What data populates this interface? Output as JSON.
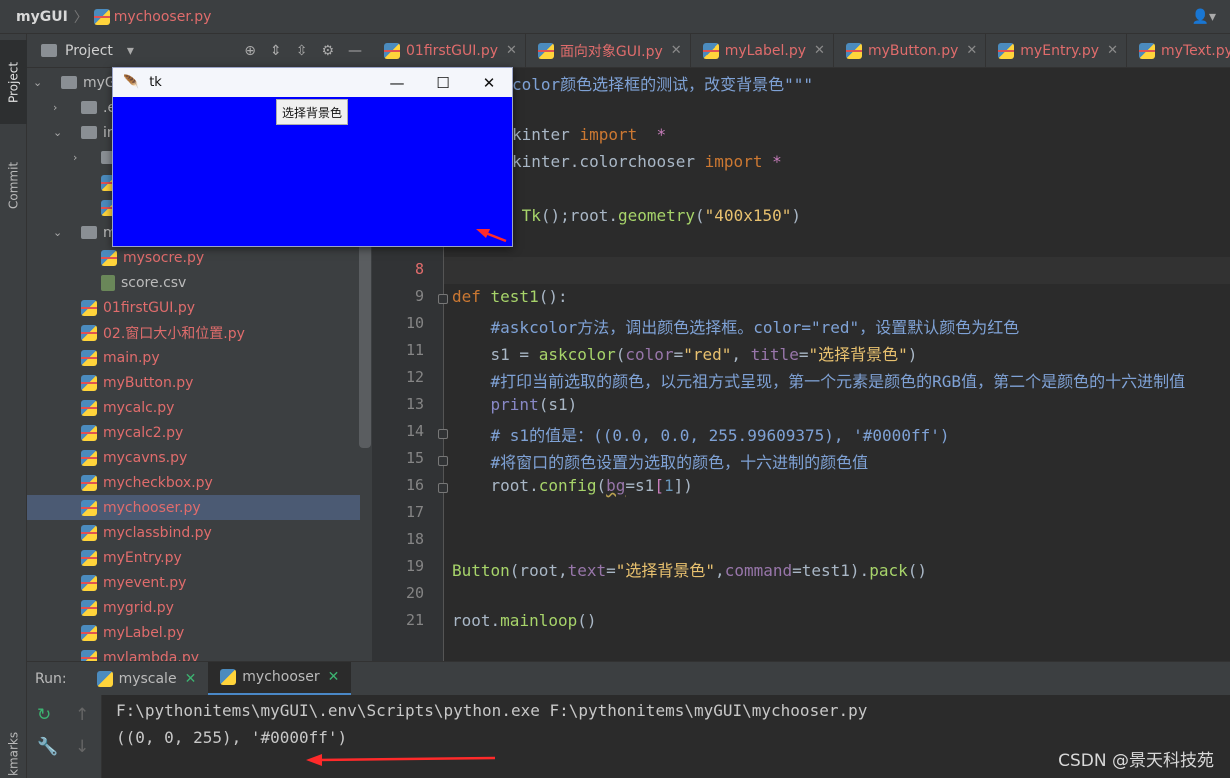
{
  "titlebar": {
    "project": "myGUI",
    "separator": "〉",
    "file": "mychooser.py",
    "user_icon": "user-icon"
  },
  "side": {
    "project_tab": "Project",
    "commit_tab": "Commit",
    "bookmarks_tab": "kmarks"
  },
  "project_panel": {
    "title": "Project",
    "dropdown": "▾"
  },
  "tree": [
    {
      "label": "myG",
      "type": "folder",
      "expanded": true
    },
    {
      "label": ".e",
      "type": "folder",
      "expanded": false
    },
    {
      "label": "in",
      "type": "folder",
      "expanded": true
    },
    {
      "label": "",
      "type": "folder",
      "expanded": false
    },
    {
      "label": "",
      "type": "file"
    },
    {
      "label": "",
      "type": "file"
    },
    {
      "label": "m",
      "type": "folder",
      "expanded": true
    },
    {
      "label": "mysocre.py",
      "type": "py"
    },
    {
      "label": "score.csv",
      "type": "csv"
    },
    {
      "label": "01firstGUI.py",
      "type": "py"
    },
    {
      "label": "02.窗口大小和位置.py",
      "type": "py"
    },
    {
      "label": "main.py",
      "type": "py"
    },
    {
      "label": "myButton.py",
      "type": "py"
    },
    {
      "label": "mycalc.py",
      "type": "py"
    },
    {
      "label": "mycalc2.py",
      "type": "py"
    },
    {
      "label": "mycavns.py",
      "type": "py"
    },
    {
      "label": "mycheckbox.py",
      "type": "py"
    },
    {
      "label": "mychooser.py",
      "type": "py",
      "selected": true
    },
    {
      "label": "myclassbind.py",
      "type": "py"
    },
    {
      "label": "myEntry.py",
      "type": "py"
    },
    {
      "label": "myevent.py",
      "type": "py"
    },
    {
      "label": "mygrid.py",
      "type": "py"
    },
    {
      "label": "myLabel.py",
      "type": "py"
    },
    {
      "label": "mylambda.py",
      "type": "py"
    }
  ],
  "tabs": [
    "01firstGUI.py",
    "面向对象GUI.py",
    "myLabel.py",
    "myButton.py",
    "myEntry.py",
    "myText.py"
  ],
  "line_numbers": [
    "",
    "",
    "",
    "",
    "",
    "",
    "",
    "8",
    "9",
    "10",
    "11",
    "12",
    "13",
    "14",
    "15",
    "16",
    "17",
    "18",
    "19",
    "20",
    "21"
  ],
  "code": {
    "l1_a": "color颜色选择框的测试，改变背景色\"\"\"",
    "l3_a": "kinter ",
    "l3_b": "import",
    "l3_c": "  *",
    "l4_a": "kinter.colorchooser ",
    "l4_b": "import",
    "l4_c": " *",
    "l6_a": " Tk",
    "l6_b": "();root.",
    "l6_c": "geometry",
    "l6_d": "(",
    "l6_e": "\"400x150\"",
    "l6_f": ")",
    "l9_a": "def ",
    "l9_b": "test1",
    "l9_c": "():",
    "l10": "    #askcolor方法，调出颜色选择框。color=\"red\"，设置默认颜色为红色",
    "l11_a": "    s1 = ",
    "l11_b": "askcolor",
    "l11_c": "(",
    "l11_d": "color",
    "l11_e": "=",
    "l11_f": "\"red\"",
    "l11_g": ", ",
    "l11_h": "title",
    "l11_i": "=",
    "l11_j": "\"选择背景色\"",
    "l11_k": ")",
    "l12": "    #打印当前选取的颜色，以元祖方式呈现，第一个元素是颜色的RGB值，第二个是颜色的十六进制值",
    "l13_a": "    ",
    "l13_b": "print",
    "l13_c": "(s1)",
    "l14": "    # s1的值是：((0.0, 0.0, 255.99609375), '#0000ff')",
    "l15": "    #将窗口的颜色设置为选取的颜色，十六进制的颜色值",
    "l16_a": "    root.",
    "l16_b": "config",
    "l16_c": "(",
    "l16_d": "bg",
    "l16_e": "=s1",
    "l16_f": "[",
    "l16_g": "1",
    "l16_h": "])",
    "l19_a": "Button",
    "l19_b": "(root,",
    "l19_c": "text",
    "l19_d": "=",
    "l19_e": "\"选择背景色\"",
    "l19_f": ",",
    "l19_g": "command",
    "l19_h": "=test1).",
    "l19_i": "pack",
    "l19_j": "()",
    "l21_a": "root.",
    "l21_b": "mainloop",
    "l21_c": "()"
  },
  "run": {
    "label": "Run:",
    "tabs": [
      "myscale",
      "mychooser"
    ],
    "console": [
      "F:\\pythonitems\\myGUI\\.env\\Scripts\\python.exe F:\\pythonitems\\myGUI\\mychooser.py",
      "((0, 0, 255), '#0000ff')"
    ]
  },
  "tk_window": {
    "title": "tk",
    "button": "选择背景色",
    "bg_color": "#0000ff"
  },
  "watermark": "CSDN @景天科技苑",
  "colors": {
    "accent": "#4a88c7",
    "error_red": "#e06c6c",
    "annotation_arrow": "#ff2a2a"
  }
}
